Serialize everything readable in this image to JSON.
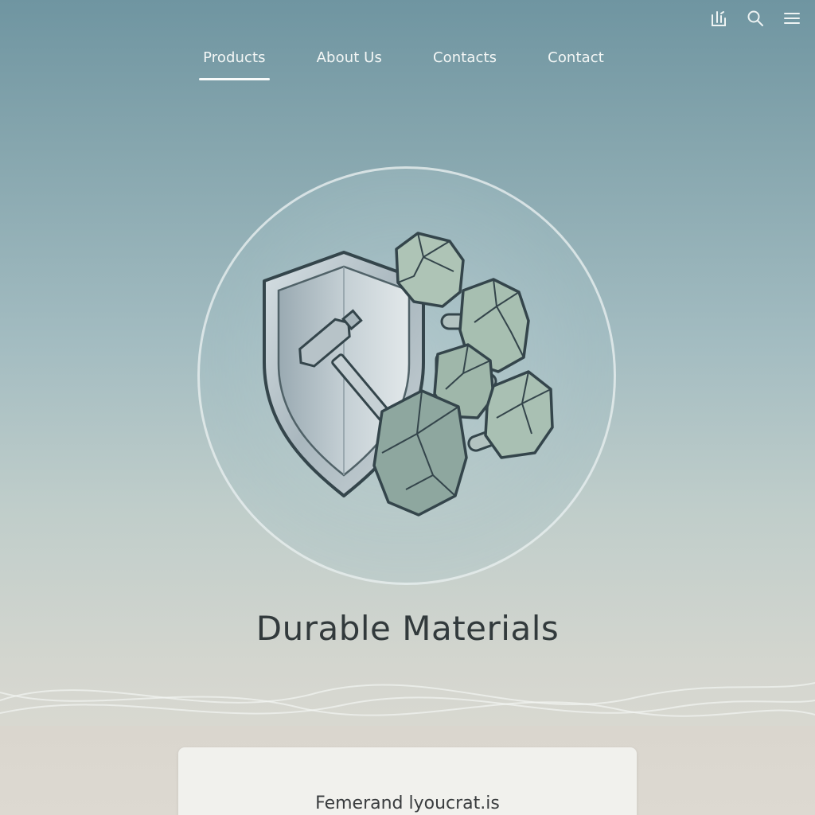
{
  "toolbar": {
    "icons": [
      "chart-icon",
      "search-icon",
      "menu-icon"
    ]
  },
  "nav": {
    "items": [
      {
        "label": "Products",
        "active": true
      },
      {
        "label": "About Us",
        "active": false
      },
      {
        "label": "Contacts",
        "active": false
      },
      {
        "label": "Contact",
        "active": false
      }
    ]
  },
  "hero": {
    "title": "Durable Materials",
    "illustration": "shield-hammer-stone-blocks-icon"
  },
  "card": {
    "text": "Femerand lyoucrat.is"
  },
  "colors": {
    "nav_text": "#f4f7f6",
    "title_text": "#323a3c",
    "shield_steel": "#b9c5cc",
    "stone_green": "#9fb5aa",
    "stone_dark": "#6d8a85"
  }
}
